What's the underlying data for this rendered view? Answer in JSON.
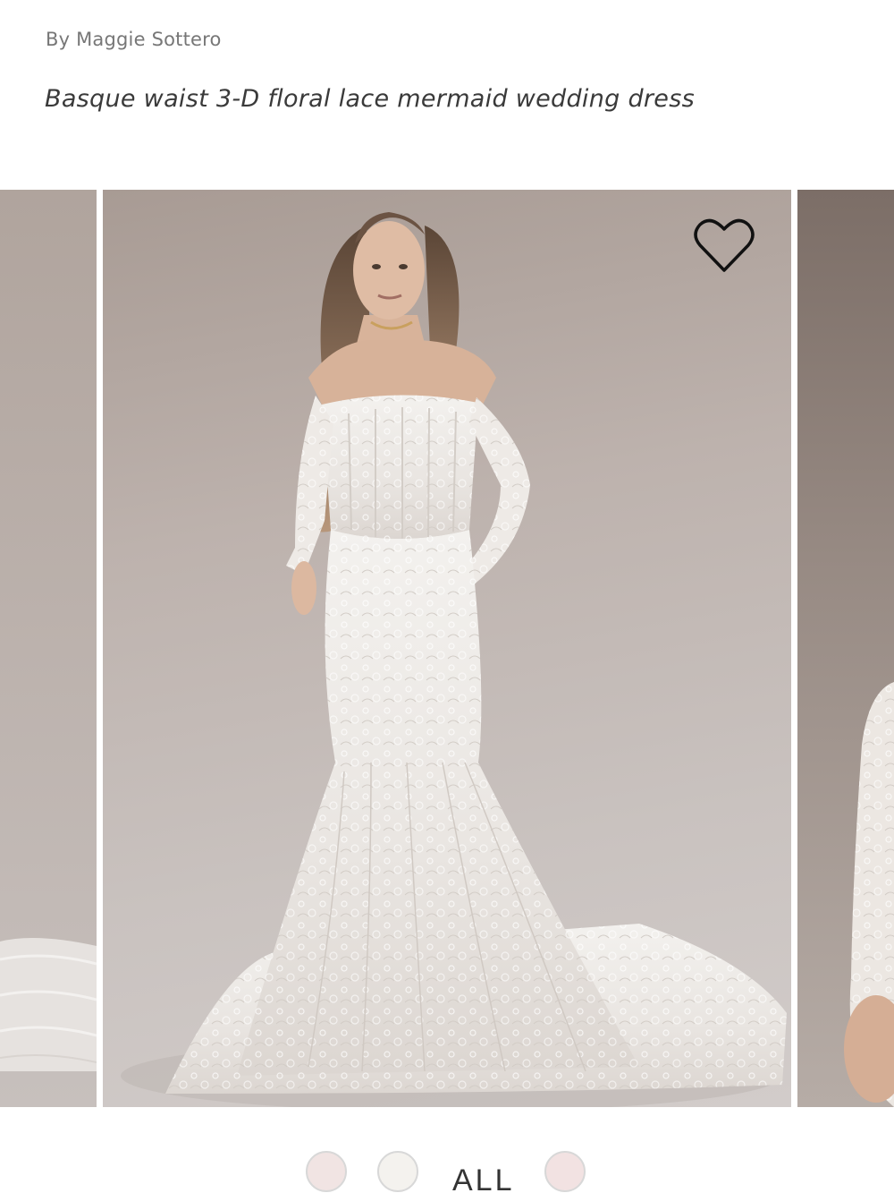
{
  "product": {
    "designer": "By Maggie Sottero",
    "tagline": "Basque waist 3-D floral lace mermaid wedding dress"
  },
  "gallery": {
    "favorite_icon": "heart-outline-icon"
  },
  "color_swatches": {
    "options": [
      {
        "color": "#f1e4e3"
      },
      {
        "color": "#f4f2ee"
      },
      {
        "label": "ALL"
      },
      {
        "color": "#f2e2e2"
      }
    ]
  }
}
